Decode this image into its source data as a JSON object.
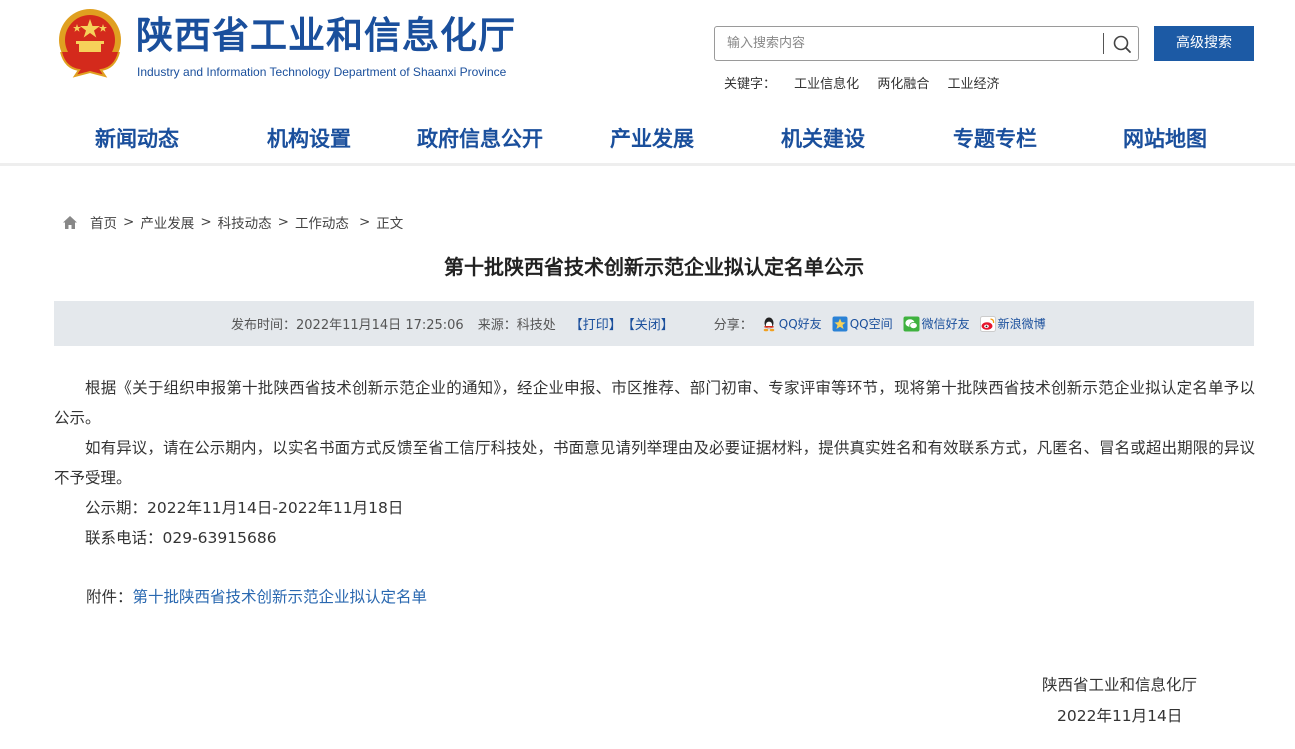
{
  "header": {
    "title": "陕西省工业和信息化厅",
    "subtitle": "Industry and Information Technology Department of Shaanxi Province",
    "search_placeholder": "输入搜索内容",
    "advanced_search_label": "高级搜索",
    "keywords_label": "关键字：",
    "keywords": [
      "工业信息化",
      "两化融合",
      "工业经济"
    ]
  },
  "nav": {
    "items": [
      "新闻动态",
      "机构设置",
      "政府信息公开",
      "产业发展",
      "机关建设",
      "专题专栏",
      "网站地图"
    ]
  },
  "breadcrumb": {
    "items": [
      "首页",
      "产业发展",
      "科技动态",
      "工作动态",
      "正文"
    ],
    "separator": ">"
  },
  "article": {
    "title": "第十批陕西省技术创新示范企业拟认定名单公示",
    "meta": {
      "publish_label": "发布时间：",
      "publish_time": "2022年11月14日 17:25:06",
      "source_label": "来源：",
      "source": "科技处",
      "print_label": "【打印】",
      "close_label": "【关闭】",
      "share_label": "分享：",
      "share_items": [
        "QQ好友",
        "QQ空间",
        "微信好友",
        "新浪微博"
      ]
    },
    "paragraphs": [
      "根据《关于组织申报第十批陕西省技术创新示范企业的通知》，经企业申报、市区推荐、部门初审、专家评审等环节，现将第十批陕西省技术创新示范企业拟认定名单予以公示。",
      "如有异议，请在公示期内，以实名书面方式反馈至省工信厅科技处，书面意见请列举理由及必要证据材料，提供真实姓名和有效联系方式，凡匿名、冒名或超出期限的异议不予受理。",
      "公示期：2022年11月14日-2022年11月18日",
      "联系电话：029-63915686"
    ],
    "attachment_label": "附件：",
    "attachment_link": "第十批陕西省技术创新示范企业拟认定名单",
    "signature_org": "陕西省工业和信息化厅",
    "signature_date": "2022年11月14日"
  },
  "colors": {
    "brand_blue": "#1a4f9c",
    "button_blue": "#1c5aa5",
    "meta_bar_bg": "#e4e8ec",
    "link_blue": "#2a68b0"
  },
  "icons": {
    "emblem": "national-emblem-icon",
    "search": "search-icon",
    "home": "home-icon",
    "qq": "qq-icon",
    "qzone": "qzone-icon",
    "wechat": "wechat-icon",
    "weibo": "weibo-icon"
  }
}
